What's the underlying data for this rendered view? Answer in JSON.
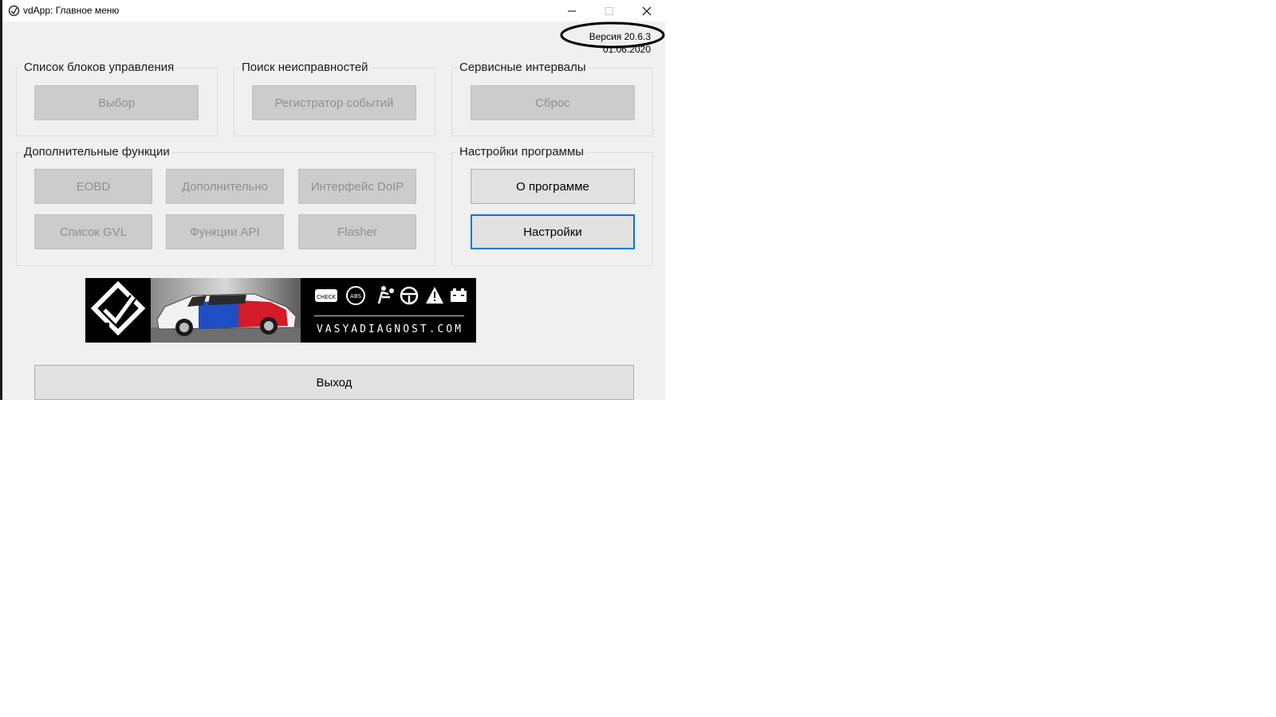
{
  "window": {
    "title": "vdApp:  Главное меню",
    "controls": {
      "minimize": "minimize-icon",
      "maximize": "maximize-icon",
      "close": "close-icon"
    }
  },
  "version": {
    "label": "Версия 20.6.3",
    "date": "01.06.2020"
  },
  "groups": {
    "control_units": {
      "title": "Список блоков управления",
      "select_button": "Выбор"
    },
    "fault_search": {
      "title": "Поиск неисправностей",
      "event_logger_button": "Регистратор событий"
    },
    "service_intervals": {
      "title": "Сервисные интервалы",
      "reset_button": "Сброс"
    },
    "extra_functions": {
      "title": "Дополнительные функции",
      "buttons": [
        "EOBD",
        "Дополнительно",
        "Интерфейс DoIP",
        "Список GVL",
        "Функции API",
        "Flasher"
      ]
    },
    "program_settings": {
      "title": "Настройки программы",
      "about_button": "О программе",
      "settings_button": "Настройки"
    }
  },
  "banner": {
    "brand_text": "VASYADIAGNOST.COM",
    "icons": [
      "check-engine-icon",
      "abs-icon",
      "airbag-icon",
      "steering-icon",
      "warning-icon",
      "battery-icon"
    ]
  },
  "exit_button": "Выход",
  "colors": {
    "disabled_bg": "#cccccc",
    "disabled_text": "#8f8f8f",
    "focus_border": "#0078d7",
    "window_bg": "#f0f0f0"
  }
}
